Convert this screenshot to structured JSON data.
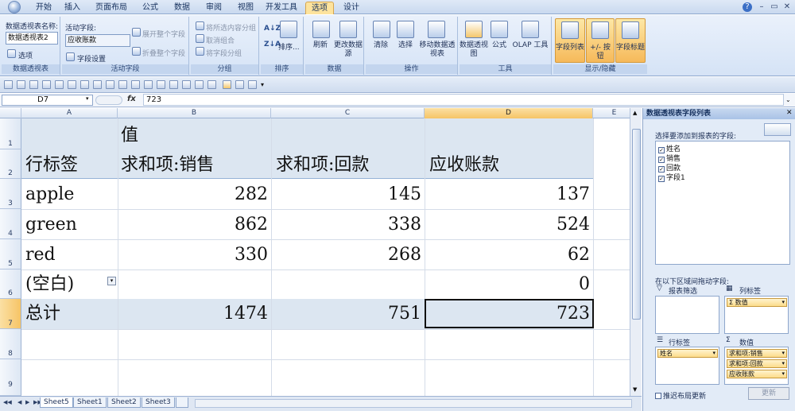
{
  "ribbon_tabs": [
    "开始",
    "插入",
    "页面布局",
    "公式",
    "数据",
    "审阅",
    "视图",
    "开发工具",
    "选项",
    "设计"
  ],
  "active_tab": "选项",
  "ribbon": {
    "pivot_name_label": "数据透视表名称:",
    "pivot_name_value": "数据透视表2",
    "options_label": "选项",
    "group1": "数据透视表",
    "active_field_label": "活动字段:",
    "active_field_value": "应收账款",
    "field_settings": "字段设置",
    "expand_field": "展开整个字段",
    "collapse_field": "折叠整个字段",
    "group2": "活动字段",
    "group_selection": "将所选内容分组",
    "ungroup": "取消组合",
    "group_field": "将字段分组",
    "group3": "分组",
    "sort": "排序...",
    "group4": "排序",
    "refresh": "刷新",
    "change_source": "更改数据源",
    "group5": "数据",
    "clear": "清除",
    "select": "选择",
    "move": "移动数据透视表",
    "group6": "操作",
    "pivot_chart": "数据透视图",
    "formula": "公式",
    "olap": "OLAP 工具",
    "group7": "工具",
    "field_list": "字段列表",
    "plusminus": "+/- 按钮",
    "field_headers": "字段标题",
    "group8": "显示/隐藏"
  },
  "formula_bar": {
    "cell_ref": "D7",
    "fx": "fx",
    "value": "723"
  },
  "columns": [
    "A",
    "B",
    "C",
    "D",
    "E"
  ],
  "rows": [
    "1",
    "2",
    "3",
    "4",
    "5",
    "6",
    "7",
    "8",
    "9"
  ],
  "pivot": {
    "values_header": "值",
    "row_label_header": "行标签",
    "col_headers": [
      "求和项:销售",
      "求和项:回款",
      "应收账款"
    ],
    "data_rows": [
      {
        "label": "apple",
        "sales": "282",
        "payment": "145",
        "receivable": "137"
      },
      {
        "label": "green",
        "sales": "862",
        "payment": "338",
        "receivable": "524"
      },
      {
        "label": "red",
        "sales": "330",
        "payment": "268",
        "receivable": "62"
      },
      {
        "label": "(空白)",
        "sales": "",
        "payment": "",
        "receivable": "0"
      }
    ],
    "total": {
      "label": "总计",
      "sales": "1474",
      "payment": "751",
      "receivable": "723"
    }
  },
  "sheet_tabs": [
    "Sheet5",
    "Sheet1",
    "Sheet2",
    "Sheet3"
  ],
  "active_sheet": "Sheet5",
  "pane": {
    "title": "数据透视表字段列表",
    "choose_label": "选择要添加到报表的字段:",
    "fields": [
      "姓名",
      "销售",
      "回款",
      "字段1"
    ],
    "drag_label": "在以下区域间拖动字段:",
    "filter_zone": "报表筛选",
    "col_zone": "列标签",
    "col_items": [
      "Σ 数值"
    ],
    "row_zone": "行标签",
    "row_items": [
      "姓名"
    ],
    "values_zone": "数值",
    "values_items": [
      "求和项:销售",
      "求和项:回款",
      "应收账款"
    ],
    "defer_label": "推迟布局更新",
    "update_btn": "更新"
  }
}
